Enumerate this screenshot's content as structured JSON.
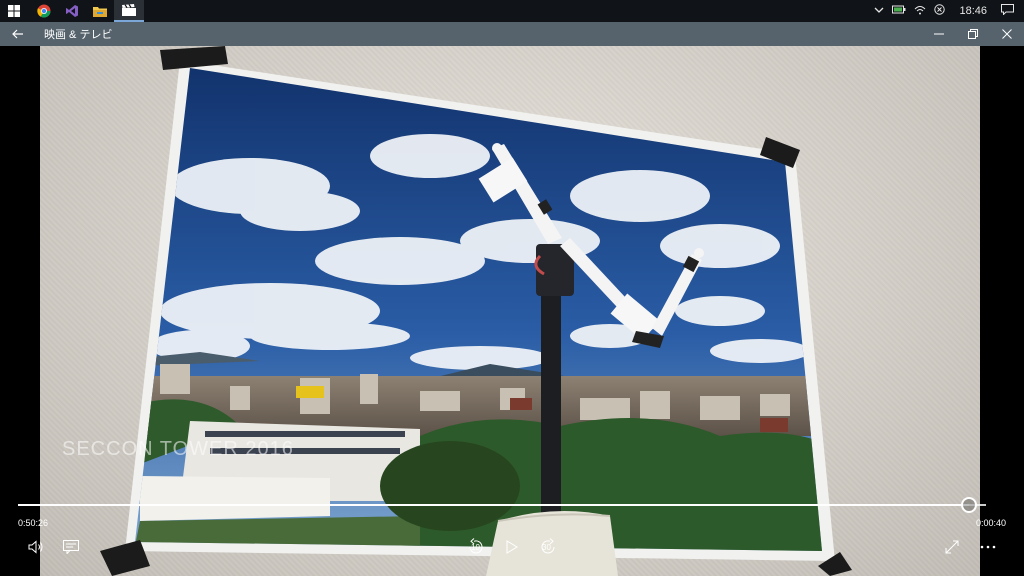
{
  "taskbar": {
    "apps": [
      {
        "name": "windows-start",
        "icon": "windows-logo-icon"
      },
      {
        "name": "chrome",
        "icon": "chrome-icon"
      },
      {
        "name": "visual-studio",
        "icon": "visual-studio-icon"
      },
      {
        "name": "file-explorer",
        "icon": "folder-icon"
      },
      {
        "name": "movies-tv",
        "icon": "clapperboard-icon"
      }
    ],
    "clock": "18:46"
  },
  "titlebar": {
    "title": "映画 & テレビ"
  },
  "video": {
    "watermark": "SECCON TOWER 2016"
  },
  "player": {
    "elapsed": "0:50:26",
    "remaining": "0:00:40",
    "progress": 0.982,
    "skip_back_seconds": "10",
    "skip_forward_seconds": "30"
  },
  "colors": {
    "titlebar": "#56636c",
    "taskbar": "#101317",
    "sky": "#1f4a8c"
  }
}
